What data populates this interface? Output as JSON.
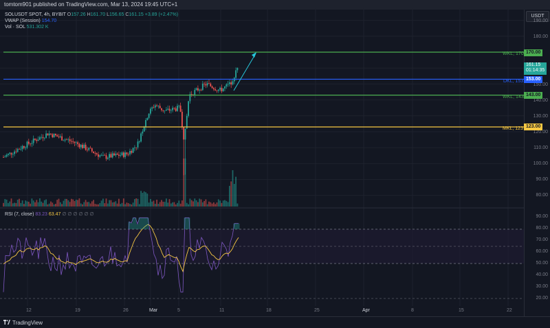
{
  "header": {
    "publish_line": "tomtom901 published on TradingView.com, Mar 13, 2024 19:45 UTC+1"
  },
  "legend": {
    "symbol": "SOLUSDT SPOT, 4h, BYBIT",
    "ohlc": {
      "o_label": "O",
      "o": "157.26",
      "h_label": "H",
      "h": "161.70",
      "l_label": "L",
      "l": "156.65",
      "c_label": "C",
      "c": "161.15",
      "change": "+3.89 (+2.47%)"
    },
    "vwap_label": "VWAP (Session)",
    "vwap_value": "154.70",
    "vol_label": "Vol · SOL",
    "vol_value": "531.302 K"
  },
  "price_axis": {
    "currency_button": "USDT",
    "labels": [
      "190.00",
      "180.00",
      "150.00",
      "140.00",
      "130.00",
      "120.00",
      "110.00",
      "100.00",
      "90.00",
      "80.00"
    ],
    "tags": {
      "wkl_170": "170.00",
      "current_price": "161.15",
      "countdown": "01:14:35",
      "dkl_153": "153.00",
      "wkl_143": "143.00",
      "mkl_123": "123.00"
    }
  },
  "levels": [
    {
      "label": "WKL, 170",
      "price": 170,
      "color": "#4caf50"
    },
    {
      "label": "DKL, 153",
      "price": 153,
      "color": "#2962ff"
    },
    {
      "label": "WKL, 143",
      "price": 143,
      "color": "#4caf50"
    },
    {
      "label": "MKL, 123",
      "price": 123,
      "color": "#f7c843"
    }
  ],
  "rsi": {
    "title": "RSI (7, close)",
    "value1": "83.23",
    "value2": "63.47",
    "placeholders": "∅ ∅ ∅ ∅ ∅ ∅",
    "axis_labels": [
      "90.00",
      "80.00",
      "70.00",
      "60.00",
      "50.00",
      "40.00",
      "30.00",
      "20.00"
    ]
  },
  "time_axis": {
    "labels": [
      "12",
      "19",
      "26",
      "Mar",
      "5",
      "11",
      "18",
      "25",
      "Apr",
      "8",
      "15",
      "22"
    ]
  },
  "footer": {
    "brand": "TradingView"
  },
  "colors": {
    "up": "#26a69a",
    "down": "#ef5350",
    "rsi_line": "#7e57c2",
    "rsi_ma": "#f7c843",
    "arrow": "#26c6da"
  }
}
